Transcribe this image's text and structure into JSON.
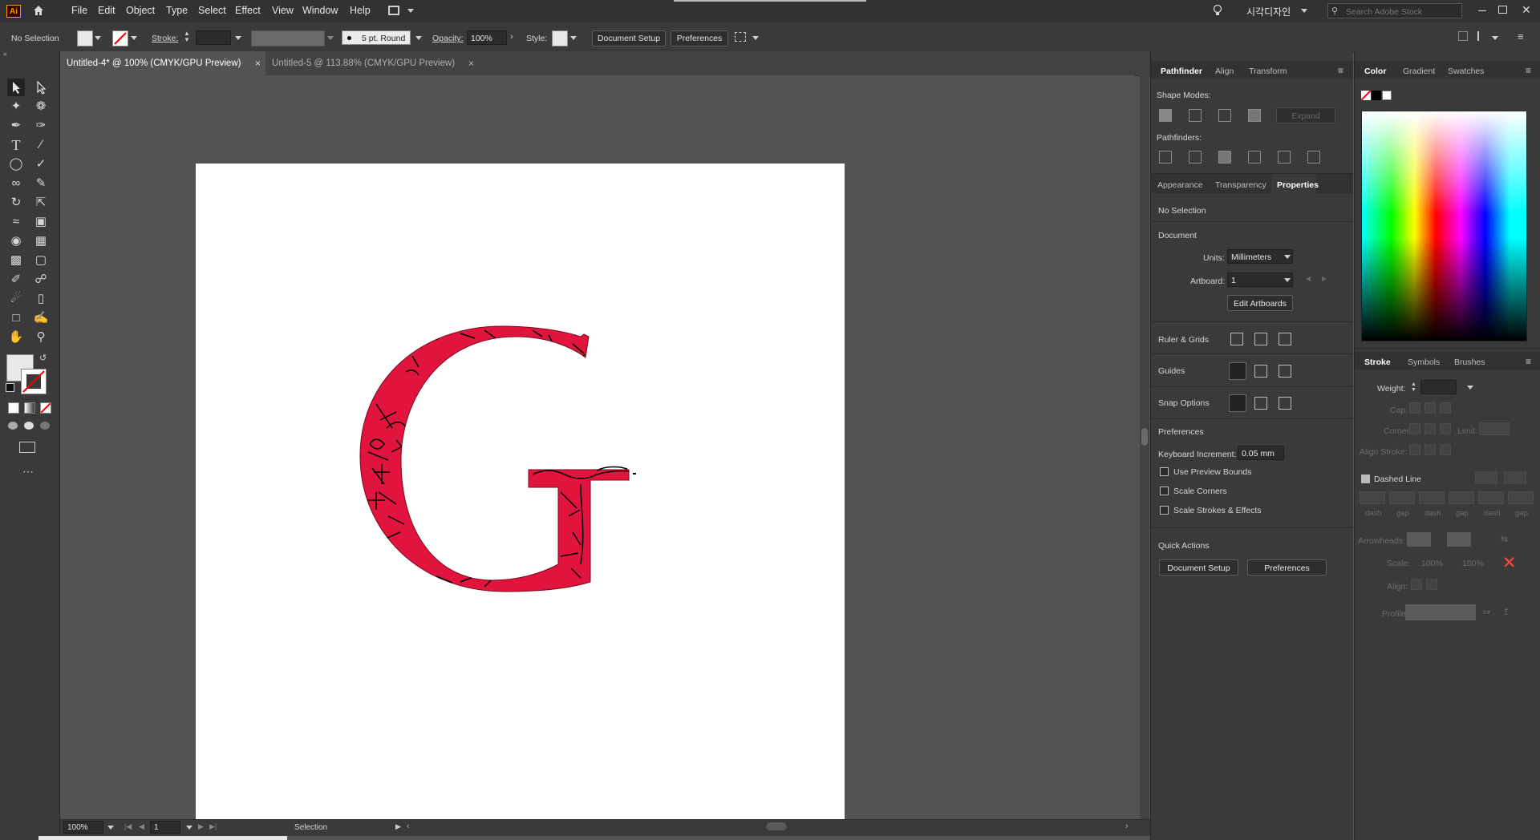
{
  "app": {
    "logo": "Ai",
    "title_korean": "시각디자인",
    "search_placeholder": "Search Adobe Stock"
  },
  "menu": [
    "File",
    "Edit",
    "Object",
    "Type",
    "Select",
    "Effect",
    "View",
    "Window",
    "Help"
  ],
  "control_bar": {
    "selection_status": "No Selection",
    "stroke_label": "Stroke:",
    "brush_value": "5 pt. Round",
    "opacity_label": "Opacity:",
    "opacity_value": "100%",
    "style_label": "Style:",
    "document_setup": "Document Setup",
    "preferences": "Preferences"
  },
  "document_tabs": [
    {
      "label": "Untitled-4* @ 100% (CMYK/GPU Preview)",
      "active": true
    },
    {
      "label": "Untitled-5 @ 113.88% (CMYK/GPU Preview)",
      "active": false
    }
  ],
  "artwork": {
    "letter": "G",
    "fill_color": "#e0143c",
    "pattern_color": "#000000"
  },
  "status_bar": {
    "zoom": "100%",
    "artboard_index": "1",
    "tool": "Selection"
  },
  "pathfinder_panel": {
    "tabs": [
      "Pathfinder",
      "Align",
      "Transform"
    ],
    "shape_modes_label": "Shape Modes:",
    "expand_label": "Expand",
    "pathfinders_label": "Pathfinders:"
  },
  "properties_panel": {
    "tabs": [
      "Appearance",
      "Transparency",
      "Properties"
    ],
    "no_selection": "No Selection",
    "document_label": "Document",
    "units_label": "Units:",
    "units_value": "Millimeters",
    "artboard_label": "Artboard:",
    "artboard_value": "1",
    "edit_artboards": "Edit Artboards",
    "ruler_grids": "Ruler & Grids",
    "guides": "Guides",
    "snap_options": "Snap Options",
    "preferences_label": "Preferences",
    "keyboard_increment_label": "Keyboard Increment:",
    "keyboard_increment_value": "0.05 mm",
    "checkboxes": [
      "Use Preview Bounds",
      "Scale Corners",
      "Scale Strokes & Effects"
    ],
    "quick_actions": "Quick Actions",
    "qa_document_setup": "Document Setup",
    "qa_preferences": "Preferences"
  },
  "color_panel": {
    "tabs": [
      "Color",
      "Gradient",
      "Swatches"
    ]
  },
  "stroke_panel": {
    "tabs": [
      "Stroke",
      "Symbols",
      "Brushes"
    ],
    "weight_label": "Weight:",
    "cap_label": "Cap:",
    "corner_label": "Corner:",
    "limit_label": "Limit:",
    "align_stroke_label": "Align Stroke:",
    "dashed_line": "Dashed Line",
    "dash_labels": [
      "dash",
      "gap",
      "dash",
      "gap",
      "dash",
      "gap"
    ],
    "arrowheads_label": "Arrowheads:",
    "scale_label": "Scale:",
    "scale_value_1": "100%",
    "scale_value_2": "100%",
    "align_label": "Align:",
    "profile_label": "Profile:"
  }
}
